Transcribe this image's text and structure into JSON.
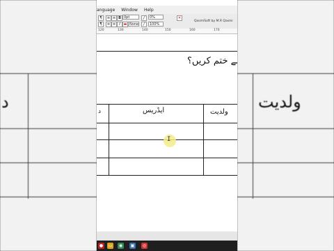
{
  "menubar": {
    "items": [
      "anguage",
      "Window",
      "Help"
    ]
  },
  "toolbar": {
    "btn_b": "B",
    "btn_i": "I",
    "unit_field": "0pt",
    "percent_field": "0%",
    "none_field": "None",
    "zoom_field": "100%",
    "qasmi_label": "QasmiSoft by M.R Qasmi"
  },
  "ruler": {
    "ticks": [
      "120",
      "130",
      "140",
      "150",
      "160",
      "170"
    ]
  },
  "document": {
    "question": "یا کالم کو کیسے ختم کریں؟",
    "col_address": "ایڈریس",
    "col_parentage": "ولدیت",
    "col_partial": "د"
  },
  "right_panel": {
    "big_text": "ولدیت"
  },
  "left_panel": {
    "big_text": "د"
  },
  "colors": {
    "cursor_highlight": "#f3ec8a",
    "taskbar": "#1f1f1f"
  },
  "taskbar": {
    "icons": [
      "app-icon",
      "folder-icon",
      "chrome-icon",
      "editor-icon",
      "record-icon"
    ]
  }
}
